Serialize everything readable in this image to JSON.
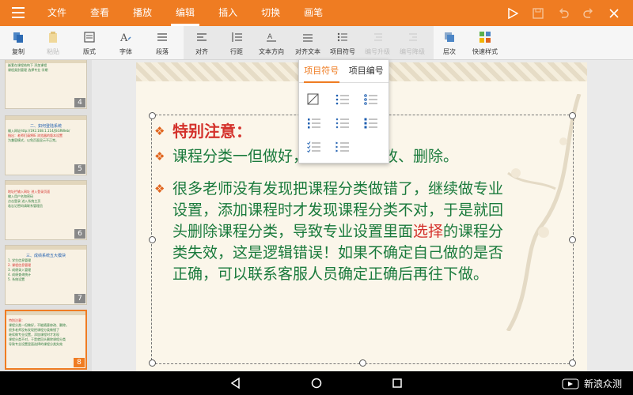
{
  "topbar": {
    "tabs": [
      "文件",
      "查看",
      "播放",
      "编辑",
      "插入",
      "切换",
      "画笔"
    ],
    "active_tab": "编辑"
  },
  "toolbar": {
    "tools": [
      {
        "label": "复制",
        "icon": "copy-icon",
        "enabled": true
      },
      {
        "label": "粘贴",
        "icon": "paste-icon",
        "enabled": false
      },
      {
        "label": "版式",
        "icon": "layout-icon",
        "enabled": true
      },
      {
        "label": "字体",
        "icon": "font-icon",
        "enabled": true
      },
      {
        "label": "段落",
        "icon": "paragraph-icon",
        "enabled": true
      },
      {
        "label": "对齐",
        "icon": "align-icon",
        "enabled": true
      },
      {
        "label": "行距",
        "icon": "line-spacing-icon",
        "enabled": true
      },
      {
        "label": "文本方向",
        "icon": "text-direction-icon",
        "enabled": true
      },
      {
        "label": "对齐文本",
        "icon": "align-text-icon",
        "enabled": true
      },
      {
        "label": "项目符号",
        "icon": "bullets-icon",
        "enabled": true
      },
      {
        "label": "编号升级",
        "icon": "promote-icon",
        "enabled": false
      },
      {
        "label": "编号降级",
        "icon": "demote-icon",
        "enabled": false
      },
      {
        "label": "层次",
        "icon": "layer-icon",
        "enabled": true
      },
      {
        "label": "快速样式",
        "icon": "quick-style-icon",
        "enabled": true
      }
    ]
  },
  "bullets_dropdown": {
    "tabs": [
      "项目符号",
      "项目编号"
    ],
    "active_tab": "项目符号"
  },
  "thumbnails": [
    {
      "num": "4",
      "lines": [
        "嵌套在课程结构下 添加课程",
        "课程类别管理 选择专业 学期"
      ]
    },
    {
      "num": "5",
      "title": "二、如何登陆系统",
      "lines": [
        "输入网址http://192.168.1.114/JSGRWeb/",
        "指出：老师们请将IE 浏览器的版本设置",
        "为兼容模式，以免页面显示不正常。"
      ]
    },
    {
      "num": "6",
      "lines": [
        "地址栏输入网址 进入登录页面",
        "输入用户名和密码",
        "点击登录 进入系统主页",
        "若忘记密码请联系管理员"
      ]
    },
    {
      "num": "7",
      "title": "三、成绩系统五大模块",
      "lines": [
        "1. 学生信息管理",
        "2. 课程信息管理",
        "3. 成绩录入管理",
        "4. 成绩查询统计",
        "5. 系统设置"
      ]
    },
    {
      "num": "8",
      "lines": [
        "特别注意：",
        "课程分类一但做好，不能随意修改、删除。",
        "很多老师没有发现把课程分类做错了",
        "继续做专业设置，添加课程时才发现",
        "课程分类不对，于是就回头删除课程分类",
        "导致专业设置里面选择的课程分类失效"
      ]
    }
  ],
  "slide": {
    "heading": "特别注意：",
    "paragraph1": "课程分类一但做好，不能随意修改、删除。",
    "p2_line1": "很多老师没有发现把课程分类做错了，继续做专业",
    "p2_line2": "设置，添加课程时才发现课程分类不对，于是就回",
    "p2_line3_before": "头删除课程分类，导致专业设置里面",
    "p2_highlight": "选择",
    "p2_line3_after": "的课程分",
    "p2_line4": "类失效，这是逻辑错误！如果不确定自己做的是否",
    "p2_line5": "正确，可以联系客服人员确定正确后再往下做。"
  },
  "watermark": "新浪众测",
  "colors": {
    "accent": "#ef7c22",
    "text_green": "#1a7a3c",
    "text_red": "#d4322c"
  }
}
